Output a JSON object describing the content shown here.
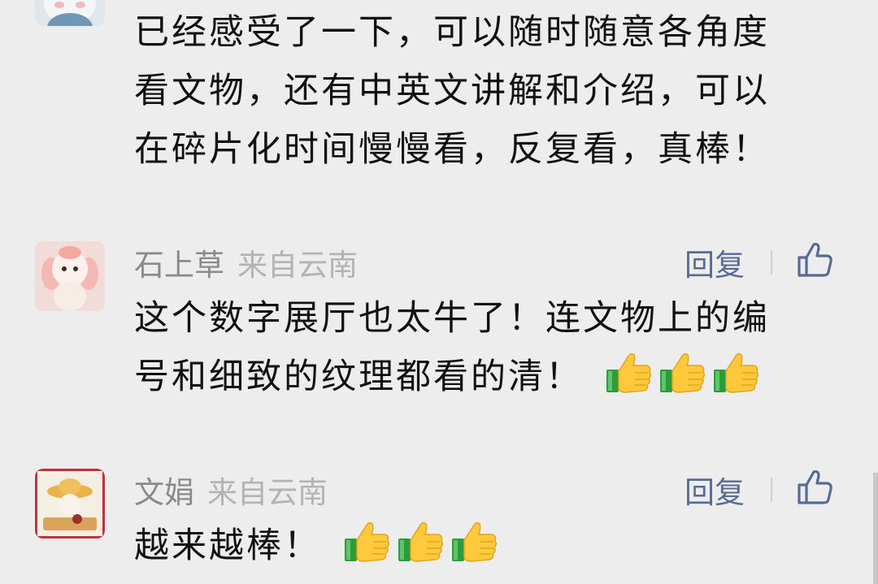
{
  "comments": [
    {
      "text_lines": [
        "已经感受了一下，可以随时随意各角度",
        "看文物，还有中英文讲解和介绍，可以",
        "在碎片化时间慢慢看，反复看，真棒！"
      ]
    },
    {
      "author": "石上草",
      "location": "来自云南",
      "reply_label": "回复",
      "text_lines": [
        "这个数字展厅也太牛了！连文物上的编",
        "号和细致的纹理都看的清！"
      ],
      "emojis": [
        "thumbs-up",
        "thumbs-up",
        "thumbs-up"
      ]
    },
    {
      "author": "文娟",
      "location": "来自云南",
      "reply_label": "回复",
      "text_lines": [
        "越来越棒！"
      ],
      "emojis": [
        "thumbs-up",
        "thumbs-up",
        "thumbs-up"
      ]
    }
  ],
  "colors": {
    "background": "#ededed",
    "author": "#8a8a8a",
    "location": "#b3b3b3",
    "reply": "#576b95",
    "text": "#111111"
  }
}
